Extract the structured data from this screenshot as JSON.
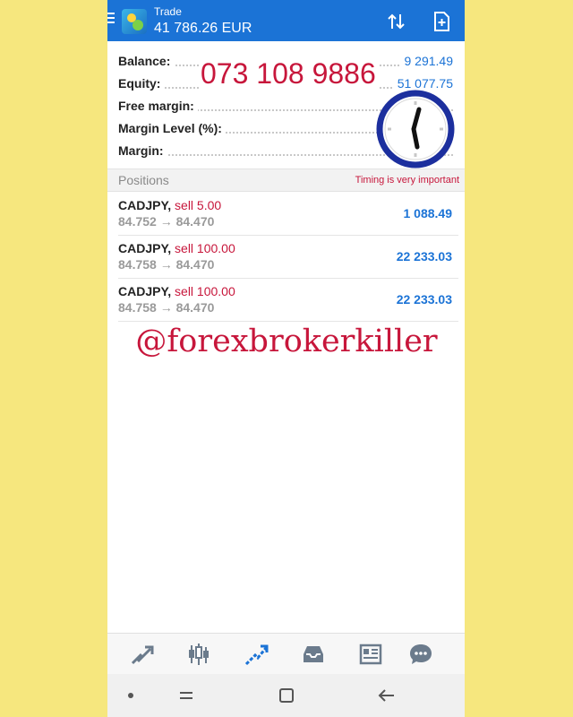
{
  "appbar": {
    "title": "Trade",
    "subtitle": "41 786.26 EUR",
    "icons": [
      "menu-icon",
      "app-logo-icon",
      "sort-icon",
      "new-order-icon"
    ]
  },
  "summary": {
    "rows": [
      {
        "label": "Balance:",
        "value": "9 291.49"
      },
      {
        "label": "Equity:",
        "value": "51 077.75"
      },
      {
        "label": "Free margin:",
        "value": ""
      },
      {
        "label": "Margin Level (%):",
        "value": ""
      },
      {
        "label": "Margin:",
        "value": ""
      }
    ]
  },
  "overlay": {
    "phone": "073 108 9886",
    "timing": "Timing is very important",
    "handle": "@forexbrokerkiller"
  },
  "positions": {
    "title": "Positions",
    "items": [
      {
        "symbol": "CADJPY,",
        "side": "sell 5.00",
        "prices": "84.752 → 84.470",
        "profit": "1 088.49"
      },
      {
        "symbol": "CADJPY,",
        "side": "sell 100.00",
        "prices": "84.758 → 84.470",
        "profit": "22 233.03"
      },
      {
        "symbol": "CADJPY,",
        "side": "sell 100.00",
        "prices": "84.758 → 84.470",
        "profit": "22 233.03"
      }
    ]
  },
  "colors": {
    "accent": "#1b73d6",
    "loss_red": "#c7163b",
    "background": "#f6e77e"
  },
  "bottom_nav": [
    "quotes-icon",
    "chart-icon",
    "trade-icon",
    "history-icon",
    "news-icon",
    "chat-icon"
  ],
  "system_nav": [
    "dot-icon",
    "recents-icon",
    "home-icon",
    "back-icon"
  ]
}
